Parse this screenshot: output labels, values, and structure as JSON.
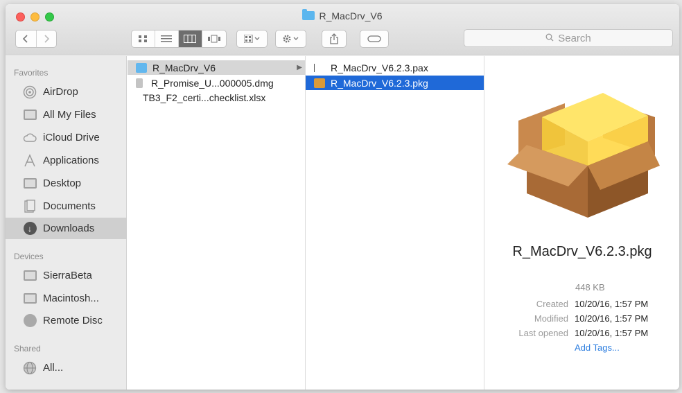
{
  "window": {
    "title": "R_MacDrv_V6"
  },
  "toolbar": {
    "back_icon": "chevron-left-icon",
    "forward_icon": "chevron-right-icon",
    "view_icons": [
      "icon-view-icon",
      "list-view-icon",
      "column-view-icon",
      "cover-flow-icon"
    ],
    "active_view": "column-view-icon",
    "arrange_icon": "arrange-grid-icon",
    "action_icon": "gear-icon",
    "share_icon": "share-icon",
    "tags_icon": "tag-icon",
    "search_placeholder": "Search"
  },
  "sidebar": {
    "favorites_header": "Favorites",
    "favorites": [
      {
        "label": "AirDrop",
        "icon": "airdrop-icon"
      },
      {
        "label": "All My Files",
        "icon": "all-files-icon"
      },
      {
        "label": "iCloud Drive",
        "icon": "cloud-icon"
      },
      {
        "label": "Applications",
        "icon": "applications-icon"
      },
      {
        "label": "Desktop",
        "icon": "desktop-icon"
      },
      {
        "label": "Documents",
        "icon": "documents-icon"
      },
      {
        "label": "Downloads",
        "icon": "downloads-icon",
        "selected": true
      }
    ],
    "devices_header": "Devices",
    "devices": [
      {
        "label": "SierraBeta",
        "icon": "disk-icon"
      },
      {
        "label": "Macintosh...",
        "icon": "disk-icon"
      },
      {
        "label": "Remote Disc",
        "icon": "disc-icon"
      }
    ],
    "shared_header": "Shared",
    "shared": [
      {
        "label": "All...",
        "icon": "network-icon"
      }
    ]
  },
  "column1": {
    "items": [
      {
        "label": "R_MacDrv_V6",
        "icon": "folder-icon",
        "selected": true
      },
      {
        "label": "R_Promise_U...000005.dmg",
        "icon": "disk-image-icon"
      },
      {
        "label": "TB3_F2_certi...checklist.xlsx",
        "icon": "document-icon"
      }
    ]
  },
  "column2": {
    "items": [
      {
        "label": "R_MacDrv_V6.2.3.pax",
        "icon": "document-icon"
      },
      {
        "label": "R_MacDrv_V6.2.3.pkg",
        "icon": "package-icon",
        "selected": true
      }
    ]
  },
  "preview": {
    "file_name": "R_MacDrv_V6.2.3.pkg",
    "size": "448 KB",
    "created_label": "Created",
    "created_value": "10/20/16, 1:57 PM",
    "modified_label": "Modified",
    "modified_value": "10/20/16, 1:57 PM",
    "opened_label": "Last opened",
    "opened_value": "10/20/16, 1:57 PM",
    "add_tags": "Add Tags..."
  },
  "colors": {
    "selection_blue": "#1f69d8",
    "folder_blue": "#5cb6ee",
    "link_blue": "#2f7fe0"
  }
}
